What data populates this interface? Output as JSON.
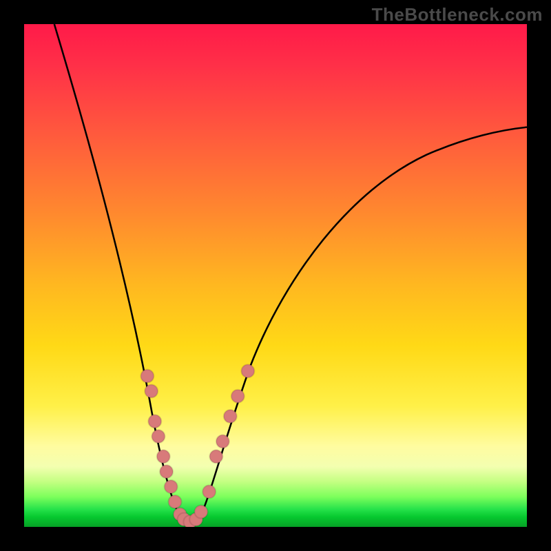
{
  "watermark": "TheBottleneck.com",
  "chart_data": {
    "type": "line",
    "title": "",
    "xlabel": "",
    "ylabel": "",
    "xlim": [
      0,
      100
    ],
    "ylim": [
      0,
      100
    ],
    "curve": {
      "left_branch": [
        {
          "x": 6,
          "y": 100
        },
        {
          "x": 10,
          "y": 86
        },
        {
          "x": 14,
          "y": 73
        },
        {
          "x": 18,
          "y": 58
        },
        {
          "x": 21,
          "y": 44
        },
        {
          "x": 23,
          "y": 34
        },
        {
          "x": 25,
          "y": 25
        },
        {
          "x": 27,
          "y": 16
        },
        {
          "x": 29,
          "y": 8
        },
        {
          "x": 31,
          "y": 3
        },
        {
          "x": 33,
          "y": 1
        }
      ],
      "right_branch": [
        {
          "x": 33,
          "y": 1
        },
        {
          "x": 35,
          "y": 3
        },
        {
          "x": 37,
          "y": 8
        },
        {
          "x": 40,
          "y": 18
        },
        {
          "x": 44,
          "y": 30
        },
        {
          "x": 50,
          "y": 44
        },
        {
          "x": 58,
          "y": 56
        },
        {
          "x": 68,
          "y": 65
        },
        {
          "x": 80,
          "y": 72
        },
        {
          "x": 92,
          "y": 76
        },
        {
          "x": 100,
          "y": 78
        }
      ]
    },
    "series": [
      {
        "name": "sample-points",
        "points": [
          {
            "x": 24.5,
            "y": 30
          },
          {
            "x": 25.3,
            "y": 27
          },
          {
            "x": 26.0,
            "y": 21
          },
          {
            "x": 26.7,
            "y": 18
          },
          {
            "x": 27.7,
            "y": 14
          },
          {
            "x": 28.3,
            "y": 11
          },
          {
            "x": 29.2,
            "y": 8
          },
          {
            "x": 30.0,
            "y": 5
          },
          {
            "x": 31.0,
            "y": 2.5
          },
          {
            "x": 31.8,
            "y": 1.5
          },
          {
            "x": 33.0,
            "y": 1
          },
          {
            "x": 34.2,
            "y": 1.5
          },
          {
            "x": 35.2,
            "y": 3
          },
          {
            "x": 36.8,
            "y": 7
          },
          {
            "x": 38.2,
            "y": 14
          },
          {
            "x": 39.5,
            "y": 17
          },
          {
            "x": 41.0,
            "y": 22
          },
          {
            "x": 42.5,
            "y": 26
          },
          {
            "x": 44.5,
            "y": 31
          }
        ]
      }
    ],
    "gradient_stops": [
      {
        "pos": 0.0,
        "color": "#ff1a49"
      },
      {
        "pos": 0.5,
        "color": "#ffb820"
      },
      {
        "pos": 0.85,
        "color": "#fffca0"
      },
      {
        "pos": 1.0,
        "color": "#06a126"
      }
    ],
    "minimum_x": 33
  }
}
